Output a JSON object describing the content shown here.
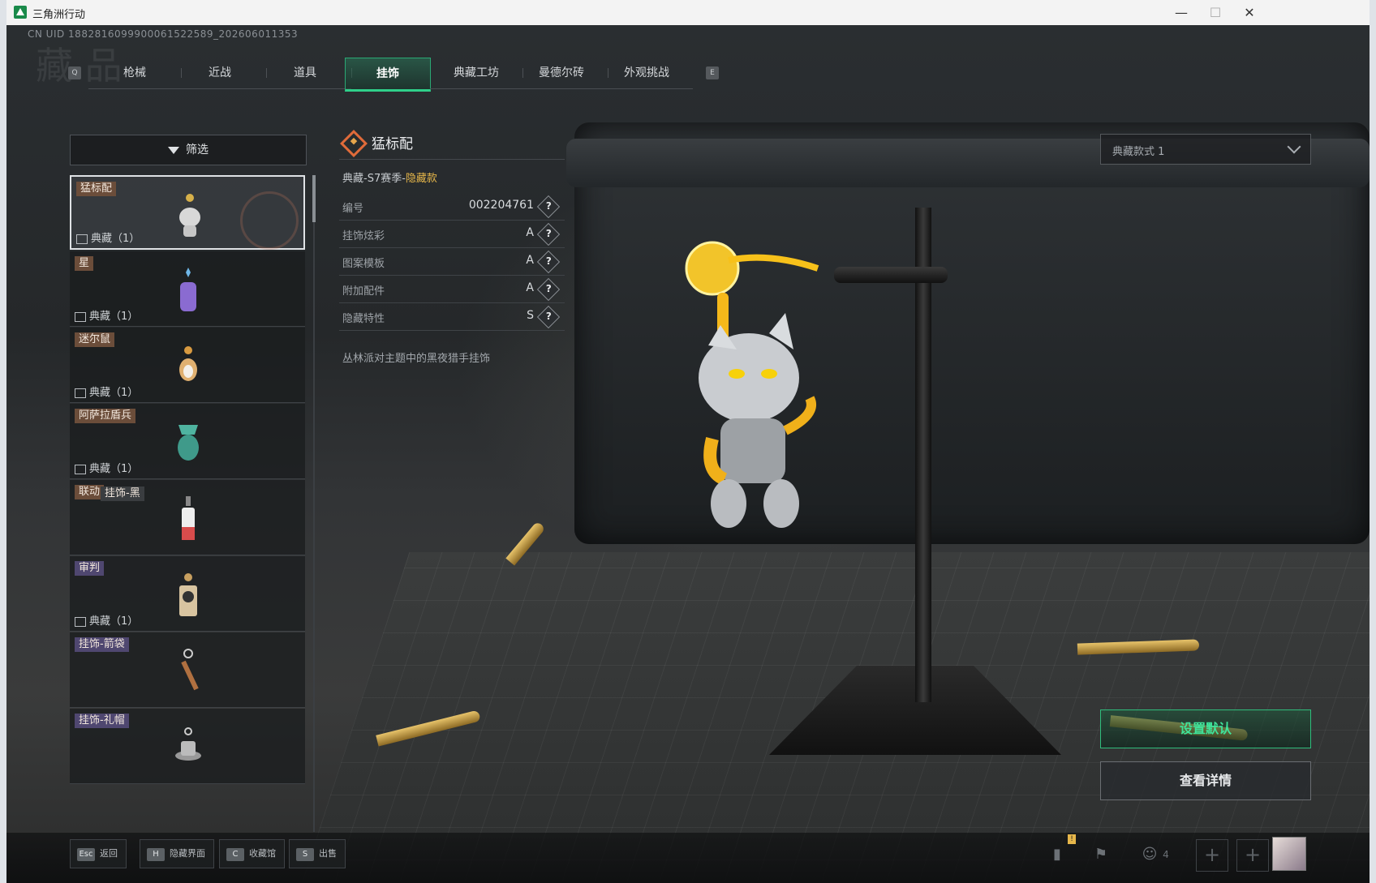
{
  "window": {
    "title": "三角洲行动",
    "controls": {
      "minimize": "—",
      "maximize": "☐",
      "close": "✕"
    }
  },
  "uid_text": "CN UID 1882816099900061522589_202606011353",
  "watermark": "藏 品",
  "tabs": {
    "left_key": "Q",
    "right_key": "E",
    "items": [
      {
        "label": "枪械",
        "active": false
      },
      {
        "label": "近战",
        "active": false
      },
      {
        "label": "道具",
        "active": false
      },
      {
        "label": "挂饰",
        "active": true
      },
      {
        "label": "典藏工坊",
        "active": false
      },
      {
        "label": "曼德尔砖",
        "active": false
      },
      {
        "label": "外观挑战",
        "active": false
      }
    ]
  },
  "filter": {
    "label": "筛选",
    "icon": "funnel-icon"
  },
  "list": {
    "items": [
      {
        "tag": "猛标配",
        "tag2": "",
        "tag_style": "brown",
        "bottom": "典藏（1）",
        "selected": true,
        "thumb_color": "#d8d8d8"
      },
      {
        "tag": "星",
        "tag2": "",
        "tag_style": "brown",
        "bottom": "典藏（1）",
        "selected": false,
        "thumb_color": "#8a6bd1"
      },
      {
        "tag": "迷尔鼠",
        "tag2": "",
        "tag_style": "brown",
        "bottom": "典藏（1）",
        "selected": false,
        "thumb_color": "#e0b070"
      },
      {
        "tag": "阿萨拉盾兵",
        "tag2": "",
        "tag_style": "brown",
        "bottom": "典藏（1）",
        "selected": false,
        "thumb_color": "#4fb3a0"
      },
      {
        "tag": "联动",
        "tag2": "挂饰-黑",
        "tag_style": "brown",
        "bottom": "",
        "selected": false,
        "thumb_color": "#d84c4c"
      },
      {
        "tag": "审判",
        "tag2": "",
        "tag_style": "purple",
        "bottom": "典藏（1）",
        "selected": false,
        "thumb_color": "#c8a060"
      },
      {
        "tag": "挂饰-箭袋",
        "tag2": "",
        "tag_style": "purple",
        "bottom": "",
        "selected": false,
        "thumb_color": "#b07040"
      },
      {
        "tag": "挂饰-礼帽",
        "tag2": "",
        "tag_style": "purple",
        "bottom": "",
        "selected": false,
        "thumb_color": "#bbbbbb"
      }
    ]
  },
  "detail": {
    "name": "猛标配",
    "season_prefix": "典藏-S7赛季-",
    "season_highlight": "隐藏款",
    "rows": [
      {
        "key": "编号",
        "value": "002204761"
      },
      {
        "key": "挂饰炫彩",
        "value": "A"
      },
      {
        "key": "图案模板",
        "value": "A"
      },
      {
        "key": "附加配件",
        "value": "A"
      },
      {
        "key": "隐藏特性",
        "value": "S"
      }
    ],
    "help_glyph": "?",
    "description": "丛林派对主题中的黑夜猎手挂饰"
  },
  "variant_select": {
    "value": "典藏款式 1"
  },
  "buttons": {
    "set_default": "设置默认",
    "view_details": "查看详情"
  },
  "bottombar": {
    "hotkeys": [
      {
        "key": "Esc",
        "label": "返回"
      },
      {
        "key": "H",
        "label": "隐藏界面"
      },
      {
        "key": "C",
        "label": "收藏馆"
      },
      {
        "key": "S",
        "label": "出售"
      }
    ],
    "notification": "!",
    "team_count": "4",
    "plus": "+"
  },
  "colors": {
    "accent": "#2fd08a",
    "highlight": "#e6b64a",
    "tag_brown": "#6b4d3a",
    "tag_purple": "#4f4770"
  }
}
